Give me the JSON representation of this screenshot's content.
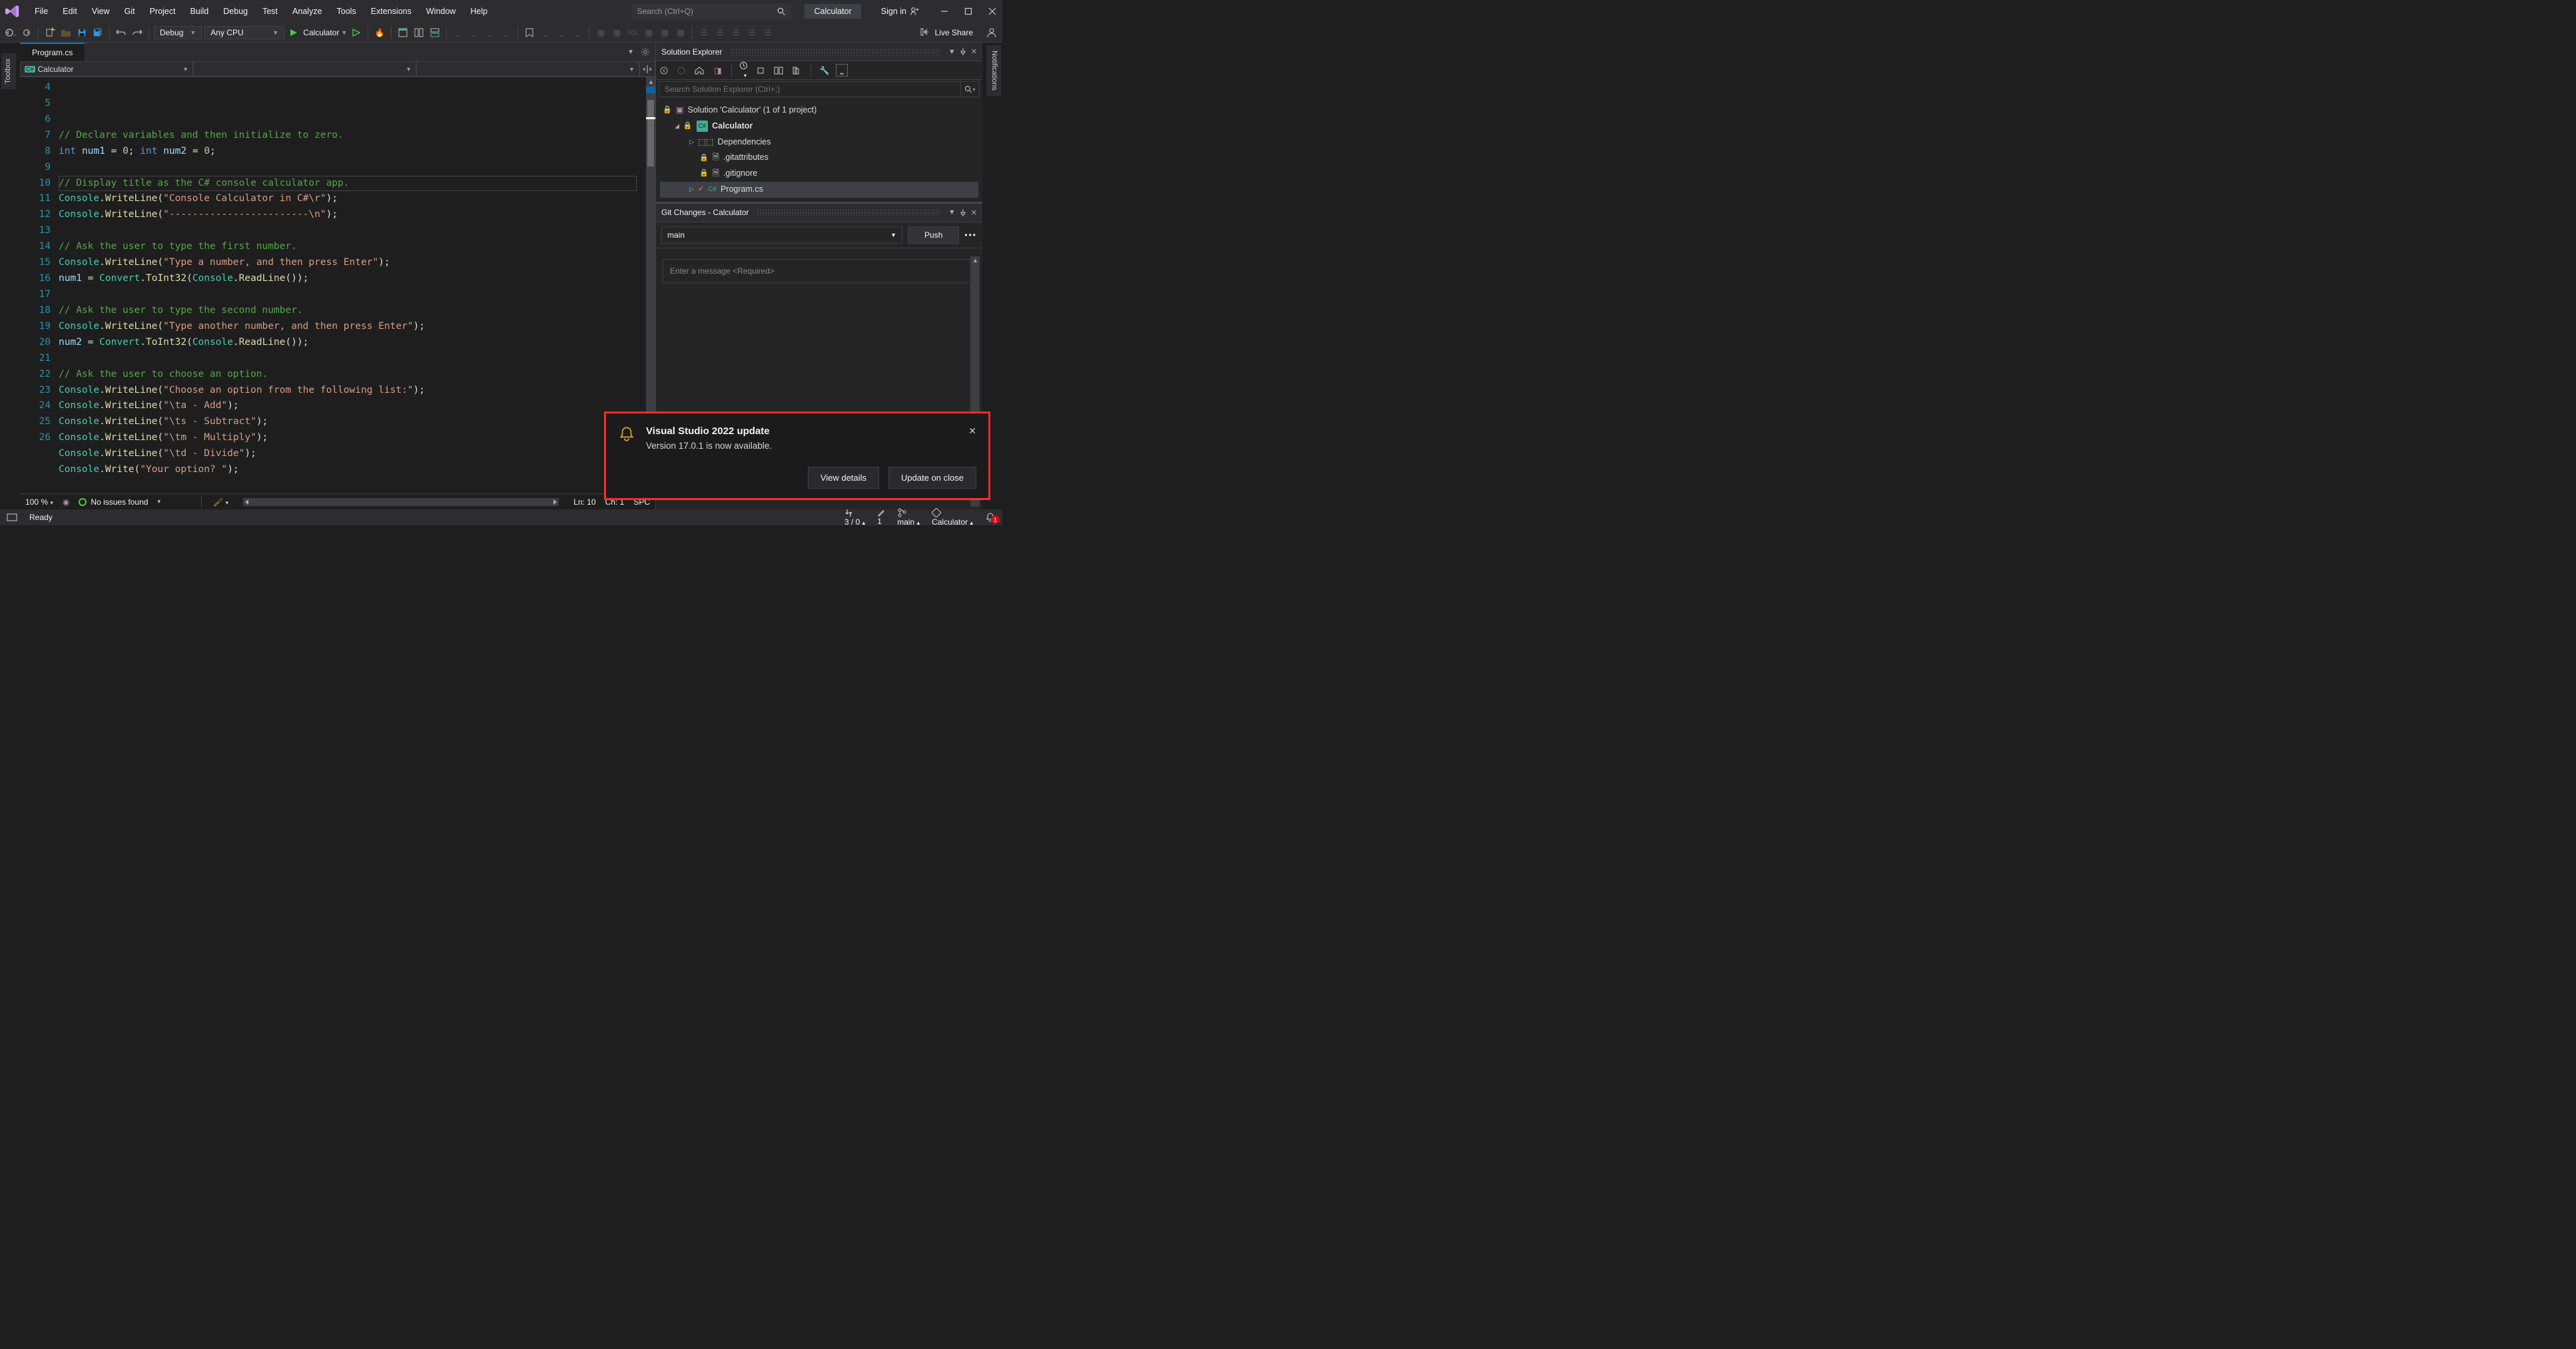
{
  "menu": [
    "File",
    "Edit",
    "View",
    "Git",
    "Project",
    "Build",
    "Debug",
    "Test",
    "Analyze",
    "Tools",
    "Extensions",
    "Window",
    "Help"
  ],
  "search": {
    "placeholder": "Search (Ctrl+Q)"
  },
  "app_name": "Calculator",
  "signin": "Sign in",
  "toolbar": {
    "config": "Debug",
    "platform": "Any CPU",
    "target": "Calculator",
    "live_share": "Live Share"
  },
  "side_tabs": {
    "left": "Toolbox",
    "right": "Notifications"
  },
  "editor": {
    "tab": "Program.cs",
    "nav1": "Calculator",
    "nav1_tag": "C#",
    "zoom": "100 %",
    "issues": "No issues found",
    "pos_ln_label": "Ln:",
    "pos_ln": "10",
    "pos_ch_label": "Ch:",
    "pos_ch": "1",
    "mode": "SPC",
    "lines": [
      {
        "n": 4,
        "raw": "// Declare variables and then initialize to zero.",
        "cls": "c-comment"
      },
      {
        "n": 5,
        "raw": "int num1 = 0; int num2 = 0;",
        "html": "<span class='c-key'>int</span> <span class='c-var'>num1</span> = <span class='c-num'>0</span>; <span class='c-key'>int</span> <span class='c-var'>num2</span> = <span class='c-num'>0</span>;"
      },
      {
        "n": 6,
        "raw": ""
      },
      {
        "n": 7,
        "raw": "// Display title as the C# console calculator app.",
        "cls": "c-comment"
      },
      {
        "n": 8,
        "raw": "Console.WriteLine(\"Console Calculator in C#\\r\");",
        "html": "<span class='c-type'>Console</span>.<span class='c-method'>WriteLine</span>(<span class='c-str'>\"Console Calculator in C#\\r\"</span>);"
      },
      {
        "n": 9,
        "raw": "Console.WriteLine(\"------------------------\\n\");",
        "html": "<span class='c-type'>Console</span>.<span class='c-method'>WriteLine</span>(<span class='c-str'>\"------------------------\\n\"</span>);"
      },
      {
        "n": 10,
        "raw": ""
      },
      {
        "n": 11,
        "raw": "// Ask the user to type the first number.",
        "cls": "c-comment"
      },
      {
        "n": 12,
        "raw": "Console.WriteLine(\"Type a number, and then press Enter\");",
        "html": "<span class='c-type'>Console</span>.<span class='c-method'>WriteLine</span>(<span class='c-str'>\"Type a number, and then press Enter\"</span>);"
      },
      {
        "n": 13,
        "raw": "num1 = Convert.ToInt32(Console.ReadLine());",
        "html": "<span class='c-var'>num1</span> = <span class='c-type'>Convert</span>.<span class='c-method'>ToInt32</span>(<span class='c-type'>Console</span>.<span class='c-method'>ReadLine</span>());"
      },
      {
        "n": 14,
        "raw": ""
      },
      {
        "n": 15,
        "raw": "// Ask the user to type the second number.",
        "cls": "c-comment"
      },
      {
        "n": 16,
        "raw": "Console.WriteLine(\"Type another number, and then press Enter\");",
        "html": "<span class='c-type'>Console</span>.<span class='c-method'>WriteLine</span>(<span class='c-str'>\"Type another number, and then press Enter\"</span>);"
      },
      {
        "n": 17,
        "raw": "num2 = Convert.ToInt32(Console.ReadLine());",
        "html": "<span class='c-var'>num2</span> = <span class='c-type'>Convert</span>.<span class='c-method'>ToInt32</span>(<span class='c-type'>Console</span>.<span class='c-method'>ReadLine</span>());"
      },
      {
        "n": 18,
        "raw": ""
      },
      {
        "n": 19,
        "raw": "// Ask the user to choose an option.",
        "cls": "c-comment"
      },
      {
        "n": 20,
        "raw": "Console.WriteLine(\"Choose an option from the following list:\");",
        "html": "<span class='c-type'>Console</span>.<span class='c-method'>WriteLine</span>(<span class='c-str'>\"Choose an option from the following list:\"</span>);"
      },
      {
        "n": 21,
        "raw": "Console.WriteLine(\"\\ta - Add\");",
        "html": "<span class='c-type'>Console</span>.<span class='c-method'>WriteLine</span>(<span class='c-str'>\"\\ta - Add\"</span>);"
      },
      {
        "n": 22,
        "raw": "Console.WriteLine(\"\\ts - Subtract\");",
        "html": "<span class='c-type'>Console</span>.<span class='c-method'>WriteLine</span>(<span class='c-str'>\"\\ts - Subtract\"</span>);"
      },
      {
        "n": 23,
        "raw": "Console.WriteLine(\"\\tm - Multiply\");",
        "html": "<span class='c-type'>Console</span>.<span class='c-method'>WriteLine</span>(<span class='c-str'>\"\\tm - Multiply\"</span>);"
      },
      {
        "n": 24,
        "raw": "Console.WriteLine(\"\\td - Divide\");",
        "html": "<span class='c-type'>Console</span>.<span class='c-method'>WriteLine</span>(<span class='c-str'>\"\\td - Divide\"</span>);"
      },
      {
        "n": 25,
        "raw": "Console.Write(\"Your option? \");",
        "html": "<span class='c-type'>Console</span>.<span class='c-method'>Write</span>(<span class='c-str'>\"Your option? \"</span>);"
      },
      {
        "n": 26,
        "raw": ""
      }
    ]
  },
  "solution_explorer": {
    "title": "Solution Explorer",
    "search_placeholder": "Search Solution Explorer (Ctrl+;)",
    "solution_label": "Solution 'Calculator' (1 of 1 project)",
    "project": "Calculator",
    "dependencies": "Dependencies",
    "gitattributes": ".gitattributes",
    "gitignore": ".gitignore",
    "program": "Program.cs"
  },
  "git_changes": {
    "title": "Git Changes - Calculator",
    "branch": "main",
    "push": "Push",
    "dots": "•••",
    "msg_placeholder": "Enter a message <Required>"
  },
  "toast": {
    "title": "Visual Studio 2022 update",
    "body": "Version 17.0.1 is now available.",
    "view": "View details",
    "update": "Update on close"
  },
  "status": {
    "ready": "Ready",
    "updown": "3 / 0",
    "pencil": "1",
    "branch": "main",
    "target": "Calculator",
    "notif_count": "1"
  }
}
